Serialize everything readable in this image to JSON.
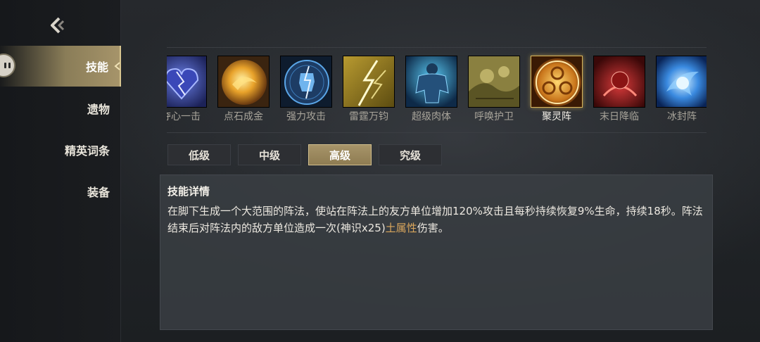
{
  "sidebar": {
    "back_icon": "back-arrow-icon",
    "items": [
      {
        "label": "技能",
        "active": true
      },
      {
        "label": "遗物",
        "active": false
      },
      {
        "label": "精英词条",
        "active": false
      },
      {
        "label": "装备",
        "active": false
      }
    ]
  },
  "skills": [
    {
      "label": "夺心一击",
      "icon": "blue-heart-crack-icon"
    },
    {
      "label": "点石成金",
      "icon": "gold-orb-icon"
    },
    {
      "label": "强力攻击",
      "icon": "blue-fist-icon"
    },
    {
      "label": "雷霆万钧",
      "icon": "lightning-icon"
    },
    {
      "label": "超级肉体",
      "icon": "muscle-body-icon"
    },
    {
      "label": "呼唤护卫",
      "icon": "summon-guard-icon"
    },
    {
      "label": "聚灵阵",
      "icon": "spirit-array-icon",
      "selected": true
    },
    {
      "label": "末日降临",
      "icon": "doom-icon"
    },
    {
      "label": "冰封阵",
      "icon": "ice-array-icon"
    }
  ],
  "tiers": [
    {
      "label": "低级",
      "active": false
    },
    {
      "label": "中级",
      "active": false
    },
    {
      "label": "高级",
      "active": true
    },
    {
      "label": "究级",
      "active": false
    }
  ],
  "detail": {
    "title": "技能详情",
    "text_before": "在脚下生成一个大范围的阵法，使站在阵法上的友方单位增加120%攻击且每秒持续恢复9%生命，持续18秒。阵法结束后对阵法内的敌方单位造成一次(神识x25)",
    "highlight": "土属性",
    "text_after": "伤害。"
  },
  "colors": {
    "accent_gold": "#a6946a",
    "highlight": "#d9a65c",
    "panel": "#3a3e43"
  }
}
